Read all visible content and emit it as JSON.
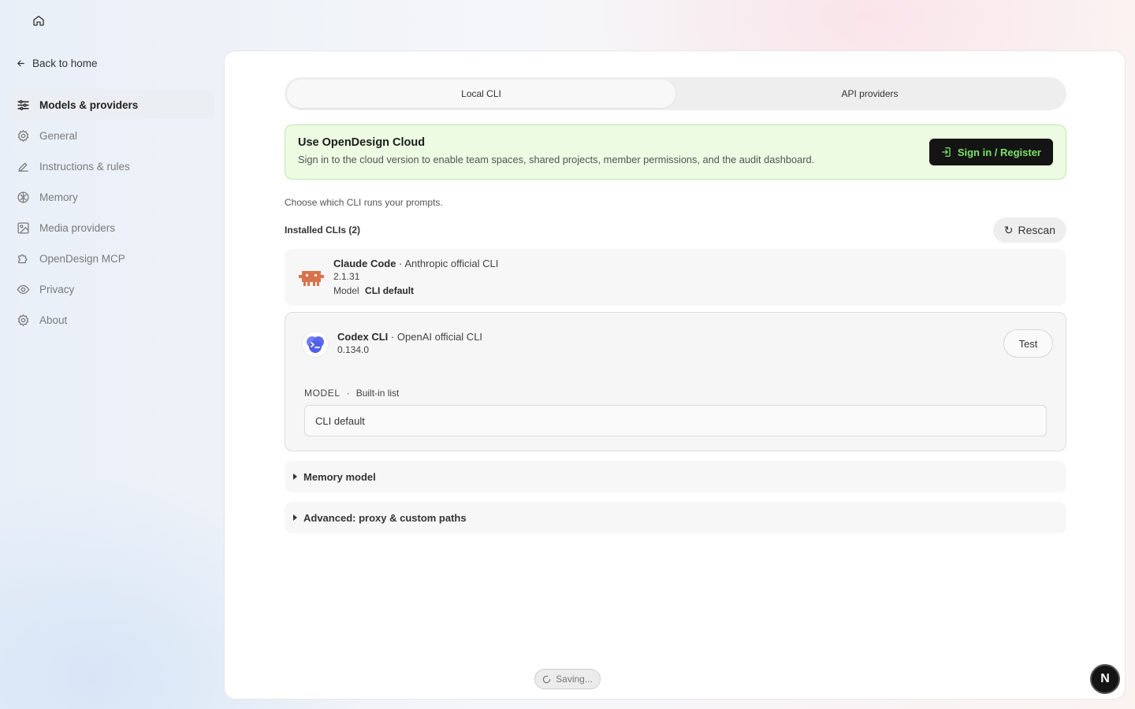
{
  "nav": {
    "back_label": "Back to home",
    "items": [
      {
        "label": "Models & providers",
        "icon": "sliders-icon",
        "active": true
      },
      {
        "label": "General",
        "icon": "gear-icon"
      },
      {
        "label": "Instructions & rules",
        "icon": "pencil-icon"
      },
      {
        "label": "Memory",
        "icon": "brain-icon"
      },
      {
        "label": "Media providers",
        "icon": "image-icon"
      },
      {
        "label": "OpenDesign MCP",
        "icon": "puzzle-icon"
      },
      {
        "label": "Privacy",
        "icon": "eye-icon"
      },
      {
        "label": "About",
        "icon": "gear-icon"
      }
    ]
  },
  "tabs": [
    "Local CLI",
    "API providers"
  ],
  "cloud": {
    "title": "Use OpenDesign Cloud",
    "description": "Sign in to the cloud version to enable team spaces, shared projects, member permissions, and the audit dashboard.",
    "button_label": "Sign in / Register",
    "accent": "#7ce36a"
  },
  "choose_text": "Choose which CLI runs your prompts.",
  "installed_label": "Installed CLIs (2)",
  "rescan_label": "Rescan",
  "clis": [
    {
      "name": "Claude Code",
      "vendor": "Anthropic official CLI",
      "version": "2.1.31",
      "model_label": "Model",
      "model_value": "CLI default",
      "logo_color": "#d9734c"
    },
    {
      "name": "Codex CLI",
      "vendor": "OpenAI official CLI",
      "version": "0.134.0",
      "test_label": "Test",
      "model_section_label": "MODEL",
      "model_source": "Built-in list",
      "model_value": "CLI default",
      "logo_color": "#5b6cf0"
    }
  ],
  "sections": [
    "Memory model",
    "Advanced: proxy & custom paths"
  ],
  "separator": "·",
  "status": {
    "saving": "Saving..."
  },
  "fab_letter": "N"
}
